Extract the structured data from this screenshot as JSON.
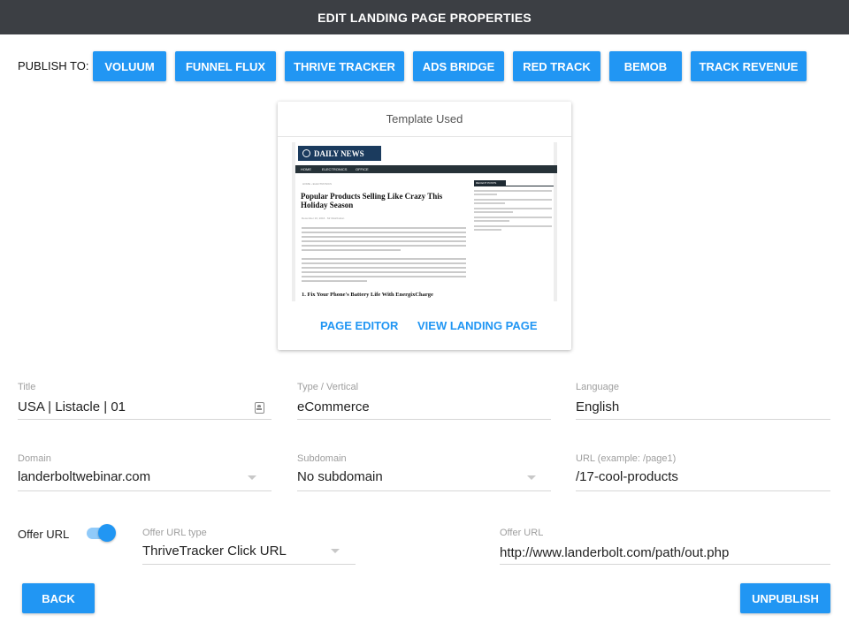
{
  "title": "EDIT LANDING PAGE PROPERTIES",
  "publish": {
    "label": "PUBLISH TO:",
    "buttons": [
      "VOLUUM",
      "FUNNEL FLUX",
      "THRIVE TRACKER",
      "ADS BRIDGE",
      "RED TRACK",
      "BEMOB",
      "TRACK REVENUE"
    ]
  },
  "template": {
    "header": "Template Used",
    "preview": {
      "logo": "DAILY NEWS",
      "nav": [
        "HOME",
        "ELECTRONICS",
        "OFFICE"
      ],
      "breadcrumb": "HOME  ›  ELECTRONICS",
      "headline": "Popular Products Selling Like Crazy This Holiday Season",
      "byline": "December 16, 2016 · Mr Distribution",
      "subheading": "1. Fix Your Phone's Battery Life With EnergixCharge",
      "sidebar_title": "RECENT POSTS"
    },
    "page_editor": "PAGE EDITOR",
    "view_landing_page": "VIEW LANDING PAGE"
  },
  "fields": {
    "title": {
      "label": "Title",
      "value": "USA | Listacle | 01"
    },
    "type": {
      "label": "Type / Vertical",
      "value": "eCommerce"
    },
    "language": {
      "label": "Language",
      "value": "English"
    },
    "domain": {
      "label": "Domain",
      "value": "landerboltwebinar.com"
    },
    "subdomain": {
      "label": "Subdomain",
      "value": "No subdomain"
    },
    "url": {
      "label": "URL (example: /page1)",
      "value": "/17-cool-products"
    },
    "offer_url_toggle": {
      "label": "Offer URL",
      "on": true
    },
    "offer_url_type": {
      "label": "Offer URL type",
      "value": "ThriveTracker Click URL"
    },
    "offer_url": {
      "label": "Offer URL",
      "value": "http://www.landerbolt.com/path/out.php"
    }
  },
  "footer": {
    "back": "BACK",
    "unpublish": "UNPUBLISH"
  },
  "colors": {
    "accent": "#2196f3",
    "titlebar": "#3c3f44"
  },
  "icons": {
    "title_field": "contact-card-icon"
  }
}
